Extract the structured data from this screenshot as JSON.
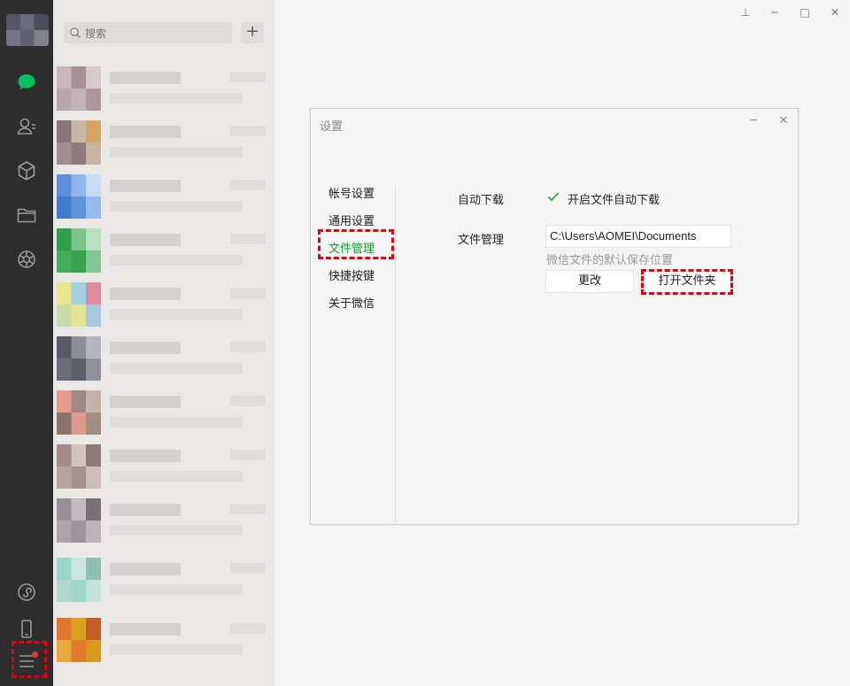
{
  "search": {
    "placeholder": "搜索"
  },
  "chat_list": {
    "add_label": "+"
  },
  "nav": {
    "icons": [
      "chat-icon",
      "contacts-icon",
      "favorites-icon",
      "files-icon",
      "moments-icon",
      "mini-programs-icon",
      "phone-icon",
      "menu-icon"
    ]
  },
  "window": {
    "pin": "⊥",
    "minimize": "─",
    "maximize": "□",
    "close": "✕"
  },
  "dialog": {
    "title": "设置",
    "minimize": "─",
    "close": "✕",
    "sidebar": [
      {
        "label": "帐号设置"
      },
      {
        "label": "通用设置"
      },
      {
        "label": "文件管理",
        "active": true
      },
      {
        "label": "快捷按键"
      },
      {
        "label": "关于微信"
      }
    ],
    "auto_download": {
      "label": "自动下载",
      "checkbox_label": "开启文件自动下载",
      "checked": true
    },
    "file_management": {
      "label": "文件管理",
      "path": "C:\\Users\\AOMEI\\Documents",
      "hint": "微信文件的默认保存位置",
      "change_button": "更改",
      "open_folder_button": "打开文件夹"
    }
  },
  "colors": {
    "accent_green": "#07a32b",
    "highlight_red": "#e0000f",
    "sidebar_dark": "#2e2e2e"
  }
}
